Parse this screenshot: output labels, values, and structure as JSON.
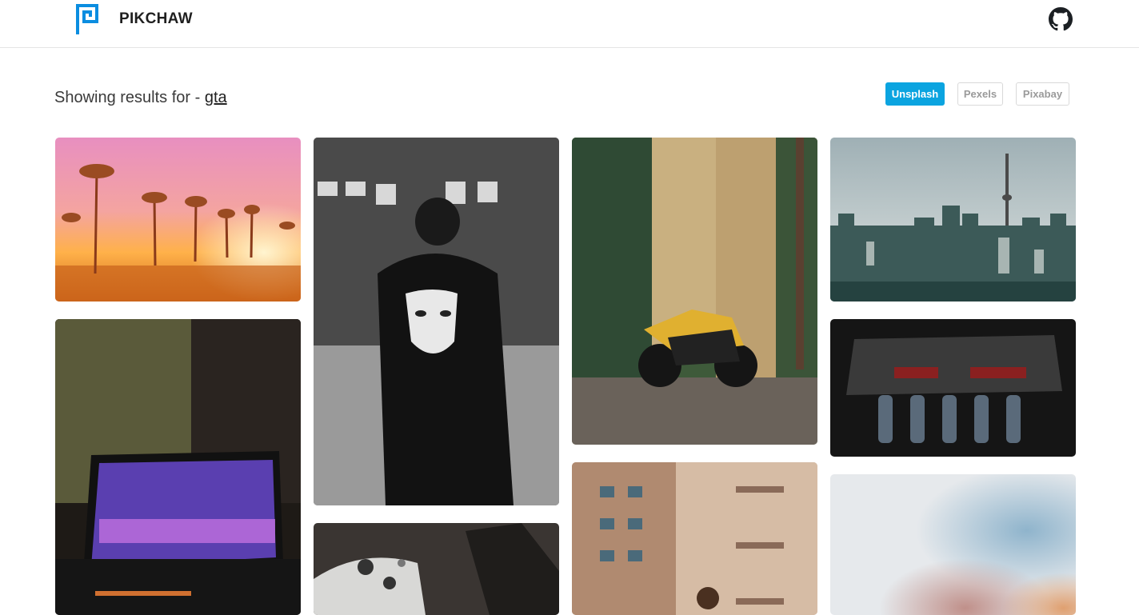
{
  "header": {
    "brand": "PIKCHAW",
    "logo_icon": "pikchaw-logo-icon",
    "github_icon": "github-icon",
    "accent_color": "#0ba4e0"
  },
  "search": {
    "prefix": "Showing results for - ",
    "query": "gta"
  },
  "sources": [
    {
      "label": "Unsplash",
      "active": true
    },
    {
      "label": "Pexels",
      "active": false
    },
    {
      "label": "Pixabay",
      "active": false
    }
  ],
  "photos": [
    {
      "subject": "palm trees at sunset"
    },
    {
      "subject": "laptop showing GTA wallpaper"
    },
    {
      "subject": "person with Guy Fawkes mask backpack"
    },
    {
      "subject": "game controller"
    },
    {
      "subject": "motorcycle on forest road"
    },
    {
      "subject": "apartment buildings"
    },
    {
      "subject": "city skyline with tower"
    },
    {
      "subject": "car engine with GTA cover"
    },
    {
      "subject": "blurred photo"
    }
  ]
}
